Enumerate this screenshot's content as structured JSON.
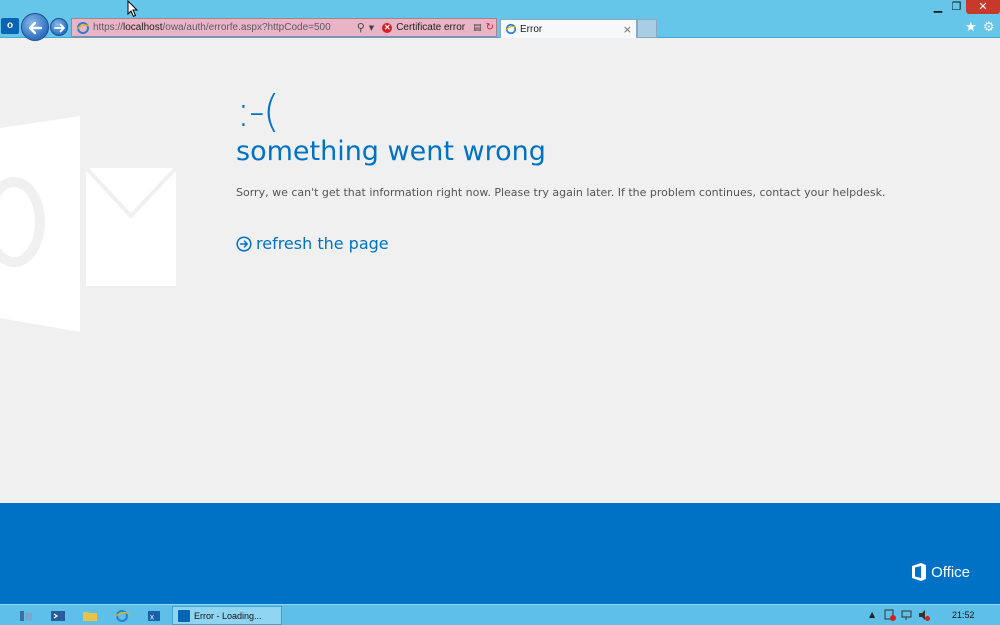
{
  "browser": {
    "address": {
      "url_prefix": "https://",
      "url_host": "localhost",
      "url_path": "/owa/auth/errorfe.aspx?httpCode=500",
      "cert_label": "Certificate error"
    },
    "tab": {
      "title": "Error"
    }
  },
  "page": {
    "frown": ":-(",
    "headline": "something went wrong",
    "message": "Sorry, we can't get that information right now. Please try again later. If the problem continues, contact your helpdesk.",
    "refresh_label": "refresh the page"
  },
  "footer": {
    "brand": "Office"
  },
  "taskbar": {
    "task_label": "Error - Loading...",
    "clock": "21:52"
  },
  "colors": {
    "brand_blue": "#0072c6",
    "chrome": "#66c6ea",
    "address_error": "#eab4c7",
    "close_red": "#c7392b"
  }
}
